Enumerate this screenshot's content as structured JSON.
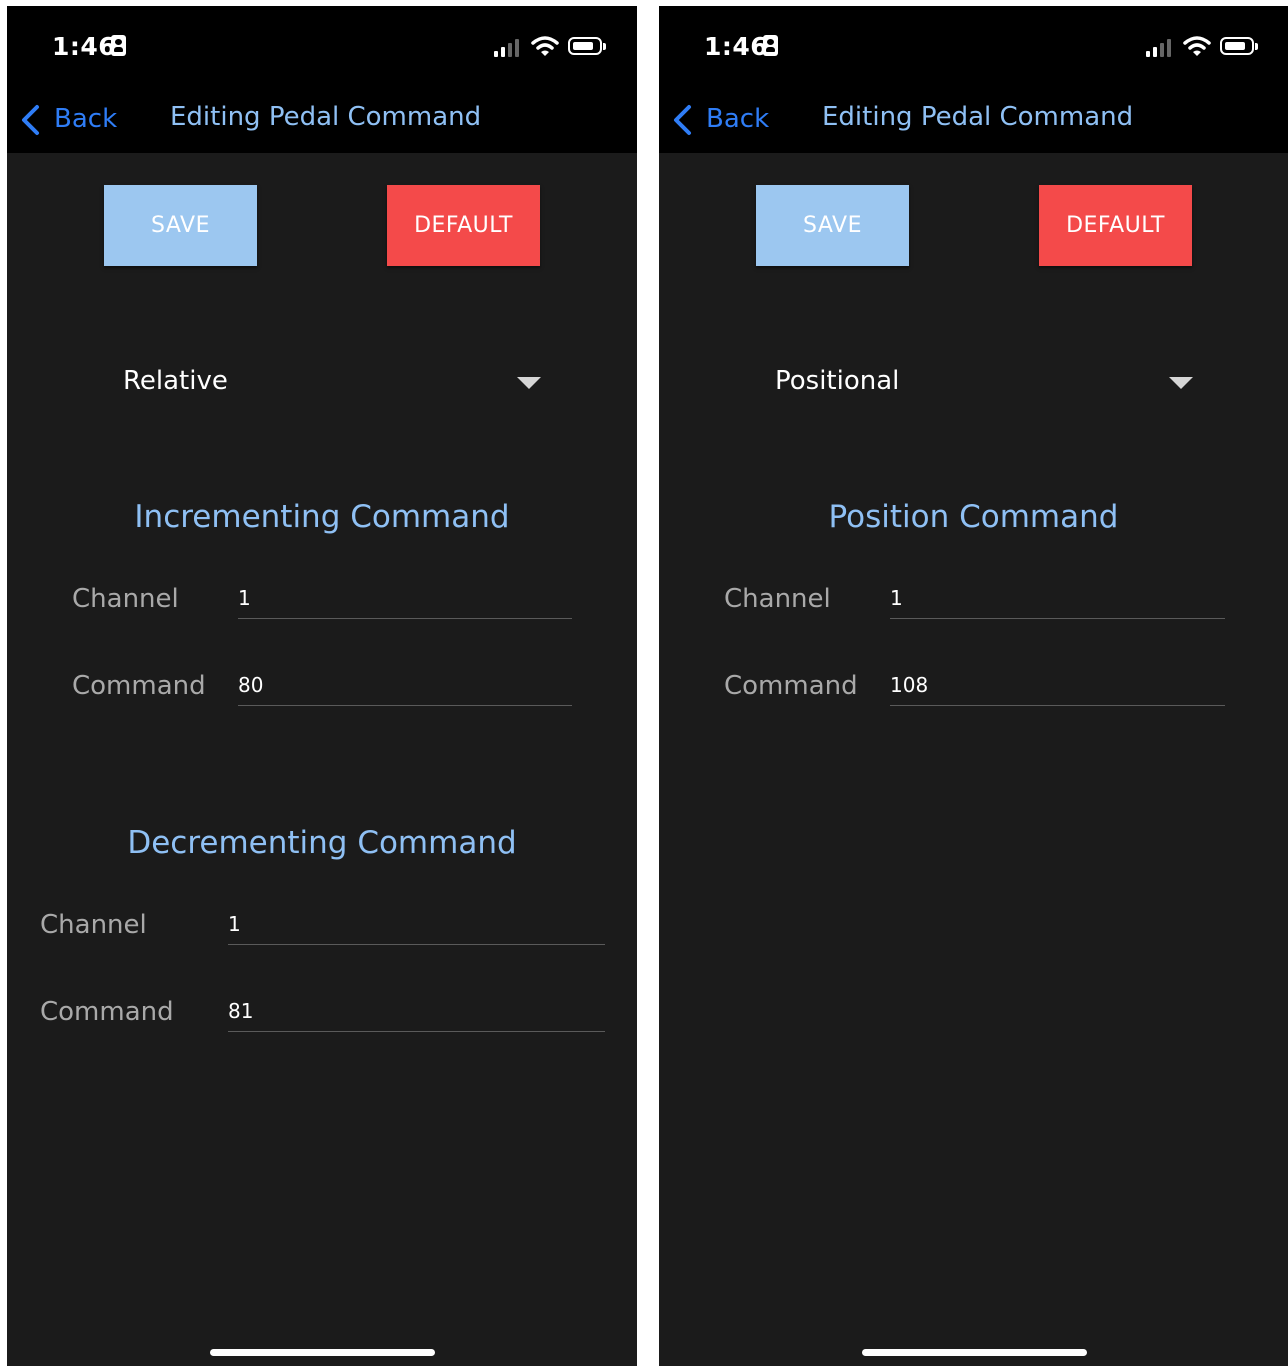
{
  "colors": {
    "background": "#1b1b1b",
    "bar_background": "#000000",
    "accent_blue": "#2f7df6",
    "title_blue": "#8fc0f4",
    "save_button": "#9cc7f0",
    "default_button": "#f44a4a"
  },
  "screens": [
    {
      "status": {
        "time": "1:46"
      },
      "nav": {
        "back_label": "Back",
        "title": "Editing Pedal Command"
      },
      "buttons": {
        "save_label": "SAVE",
        "default_label": "DEFAULT"
      },
      "mode": {
        "selected": "Relative"
      },
      "sections": [
        {
          "title": "Incrementing Command",
          "channel_label": "Channel",
          "channel_value": "1",
          "command_label": "Command",
          "command_value": "80"
        },
        {
          "title": "Decrementing Command",
          "channel_label": "Channel",
          "channel_value": "1",
          "command_label": "Command",
          "command_value": "81"
        }
      ]
    },
    {
      "status": {
        "time": "1:46"
      },
      "nav": {
        "back_label": "Back",
        "title": "Editing Pedal Command"
      },
      "buttons": {
        "save_label": "SAVE",
        "default_label": "DEFAULT"
      },
      "mode": {
        "selected": "Positional"
      },
      "sections": [
        {
          "title": "Position Command",
          "channel_label": "Channel",
          "channel_value": "1",
          "command_label": "Command",
          "command_value": "108"
        }
      ]
    }
  ]
}
